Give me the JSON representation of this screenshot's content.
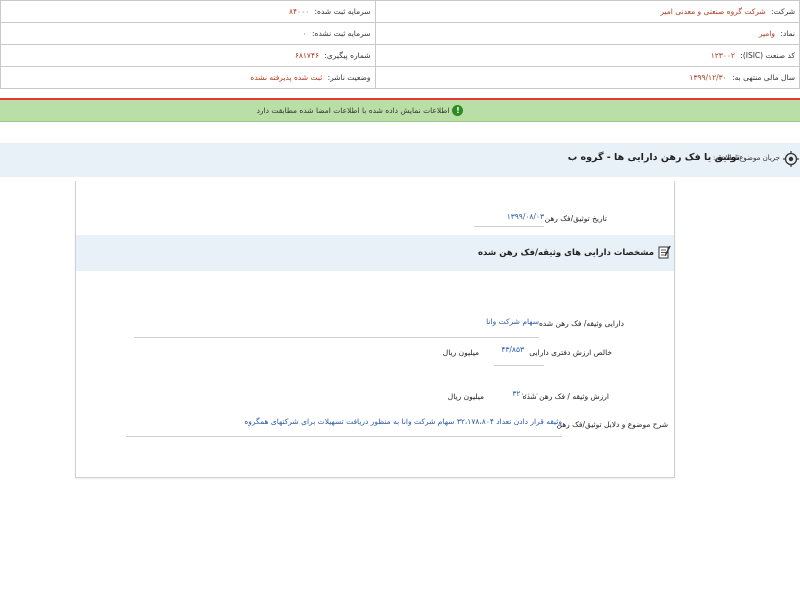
{
  "info": {
    "company_label": "شرکت:",
    "company_value": "شرکت گروه صنعتی و معدنی امیر",
    "registered_capital_label": "سرمایه ثبت شده:",
    "registered_capital_value": "۸۴۰۰۰",
    "symbol_label": "نماد:",
    "symbol_value": "وامیر",
    "unregistered_capital_label": "سرمایه ثبت نشده:",
    "unregistered_capital_value": "۰",
    "isic_label": "کد صنعت (ISIC):",
    "isic_value": "۱۲۳۰۰۲",
    "tracking_label": "شماره پیگیری:",
    "tracking_value": "۶۸۱۷۴۶",
    "fiscal_year_label": "سال مالی منتهی به:",
    "fiscal_year_value": "۱۳۹۹/۱۲/۳۰",
    "status_label": "وضعیت ناشر:",
    "status_value": "ثبت شده پذیرفته نشده"
  },
  "alert": {
    "text": "اطلاعات نمایش داده شده با اطلاعات امضا شده مطابقت دارد",
    "icon": "info-icon"
  },
  "subject": {
    "prefix": "جریان موضوع اطلاعیه:",
    "title": "توثیق یا فک رهن دارایی ها - گروه ب"
  },
  "form": {
    "date_label": "تاریخ توثیق/فک رهن",
    "date_value": "۱۳۹۹/۰۸/۰۳",
    "section_title": "مشخصات دارایی های وثیقه/فک رهن شده",
    "asset_label": "دارایی وثیقه/ فک رهن شده",
    "asset_value": "سهام شرکت وانا",
    "book_value_label": "خالص ارزش دفتری دارایی",
    "book_value_value": "۴۳/۸۵۳",
    "book_value_unit": "میلیون ریال",
    "collateral_value_label": "ارزش وثیقه / فک رهن شده",
    "collateral_value_value": "۳۲۰،۰۰۰",
    "collateral_value_unit": "میلیون ریال",
    "description_label": "شرح موضوع و دلایل توثیق/فک رهن",
    "description_value": "وثیقه قرار دادن تعداد ۳۲،۱۷۸،۸۰۴ سهام شرکت وانا به منظور دریافت تسهیلات برای شرکتهای همگروه"
  },
  "colors": {
    "value_red": "#b23b1f",
    "value_blue": "#2a5aa8",
    "alert_green": "#b9dfa6",
    "divider_red": "#e03a32",
    "bar_blue": "#e8f0f8"
  }
}
